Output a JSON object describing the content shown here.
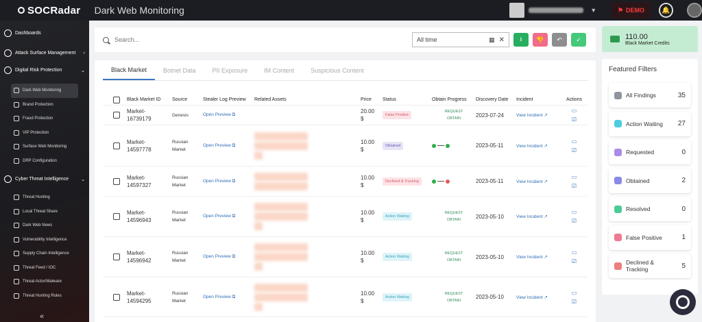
{
  "topbar": {
    "logo_text": "SOCRadar",
    "page_title": "Dark Web Monitoring",
    "demo_label": "DEMO"
  },
  "sidebar": {
    "items": [
      {
        "label": "Dashboards"
      },
      {
        "label": "Attack Surface Management"
      },
      {
        "label": "Digital Risk Protection"
      }
    ],
    "drp_sub": [
      "Dark Web Monitoring",
      "Brand Protection",
      "Fraud Protection",
      "VIP Protection",
      "Surface Web Monitoring",
      "DRP Configuration"
    ],
    "cti_label": "Cyber Threat Intelligence",
    "cti_sub": [
      "Threat Hunting",
      "Local Threat Share",
      "Dark Web News",
      "Vulnerability Intelligence",
      "Supply Chain Intelligence",
      "Threat Feed / IOC",
      "Threat Actor/Malware",
      "Threat Hunting Rules"
    ],
    "collapse_icon": "«"
  },
  "search": {
    "placeholder": "Search...",
    "date_value": "All time"
  },
  "tabs": [
    "Black Market",
    "Botnet Data",
    "PII Exposure",
    "IM Content",
    "Suspicious Content"
  ],
  "table": {
    "headers": [
      "Black Market ID",
      "Source",
      "Stealer Log Preview",
      "Related Assets",
      "Price",
      "Status",
      "Obtain Progress",
      "Discovery Date",
      "Incident",
      "Actions"
    ],
    "rows": [
      {
        "id1": "Market-",
        "id2": "16739179",
        "src1": "Genesis",
        "src2": "",
        "preview": "Open Preview",
        "price1": "20.00",
        "price2": "$",
        "status": "False Positive",
        "req1": "REQUEST",
        "req2": "OBTAIN",
        "date": "2023-07-24",
        "incident": "View Incident"
      },
      {
        "id1": "Market-",
        "id2": "14597778",
        "src1": "Russian",
        "src2": "Market",
        "preview": "Open Preview",
        "price1": "10.00",
        "price2": "$",
        "status": "Obtained",
        "date": "2023-05-11",
        "incident": "View Incident"
      },
      {
        "id1": "Market-",
        "id2": "14597327",
        "src1": "Russian",
        "src2": "Market",
        "preview": "Open Preview",
        "price1": "10.00",
        "price2": "$",
        "status": "Declined & Tracking",
        "date": "2023-05-11",
        "incident": "View Incident"
      },
      {
        "id1": "Market-",
        "id2": "14596943",
        "src1": "Russian",
        "src2": "Market",
        "preview": "Open Preview",
        "price1": "10.00",
        "price2": "$",
        "status": "Action Waiting",
        "req1": "REQUEST",
        "req2": "OBTAIN",
        "date": "2023-05-10",
        "incident": "View Incident"
      },
      {
        "id1": "Market-",
        "id2": "14596942",
        "src1": "Russian",
        "src2": "Market",
        "preview": "Open Preview",
        "price1": "10.00",
        "price2": "$",
        "status": "Action Waiting",
        "req1": "REQUEST",
        "req2": "OBTAIN",
        "date": "2023-05-10",
        "incident": "View Incident"
      },
      {
        "id1": "Market-",
        "id2": "14594295",
        "src1": "Russian",
        "src2": "Market",
        "preview": "Open Preview",
        "price1": "10.00",
        "price2": "$",
        "status": "Action Waiting",
        "req1": "REQUEST",
        "req2": "OBTAIN",
        "date": "2023-05-10",
        "incident": "View Incident"
      }
    ]
  },
  "credits": {
    "amount": "110.00",
    "label": "Black Market Credits"
  },
  "featured": {
    "title": "Featured Filters",
    "items": [
      {
        "label": "All Findings",
        "count": "35",
        "color": "#8e959e"
      },
      {
        "label": "Action Waiting",
        "count": "27",
        "color": "#4fcde0"
      },
      {
        "label": "Requested",
        "count": "0",
        "color": "#a98be8"
      },
      {
        "label": "Obtained",
        "count": "2",
        "color": "#8a8ae8"
      },
      {
        "label": "Resolved",
        "count": "0",
        "color": "#4ccb95"
      },
      {
        "label": "False Positive",
        "count": "1",
        "color": "#f07a92"
      },
      {
        "label": "Declined & Tracking",
        "count": "5",
        "color": "#ee7f7f"
      }
    ]
  },
  "colors": {
    "accent_green": "#27ae60",
    "accent_pink": "#f06d8a",
    "gray_btn": "#8e8e8e",
    "light_green": "#46c97a"
  }
}
